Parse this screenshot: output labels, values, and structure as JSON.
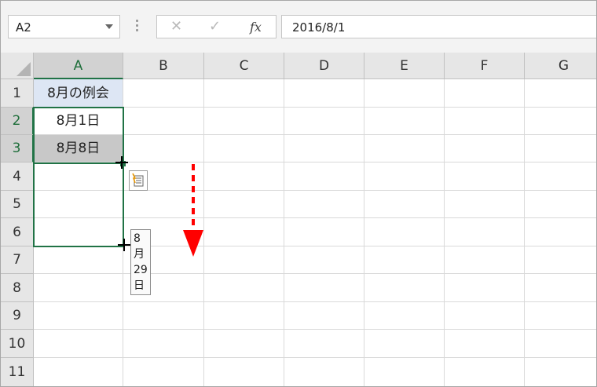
{
  "name_box": {
    "value": "A2"
  },
  "formula_bar": {
    "value": "2016/8/1",
    "cancel_glyph": "✕",
    "enter_glyph": "✓",
    "fx_glyph": "fx"
  },
  "columns": [
    "A",
    "B",
    "C",
    "D",
    "E",
    "F",
    "G"
  ],
  "rows": [
    "1",
    "2",
    "3",
    "4",
    "5",
    "6",
    "7",
    "8",
    "9",
    "10",
    "11"
  ],
  "cells": {
    "A1": "8月の例会",
    "A2": "8月1日",
    "A3": "8月8日"
  },
  "fill_tooltip": "8月29日",
  "colors": {
    "selection": "#217346",
    "header_cell_fill": "#dde6f4",
    "arrow": "#ff0000"
  }
}
